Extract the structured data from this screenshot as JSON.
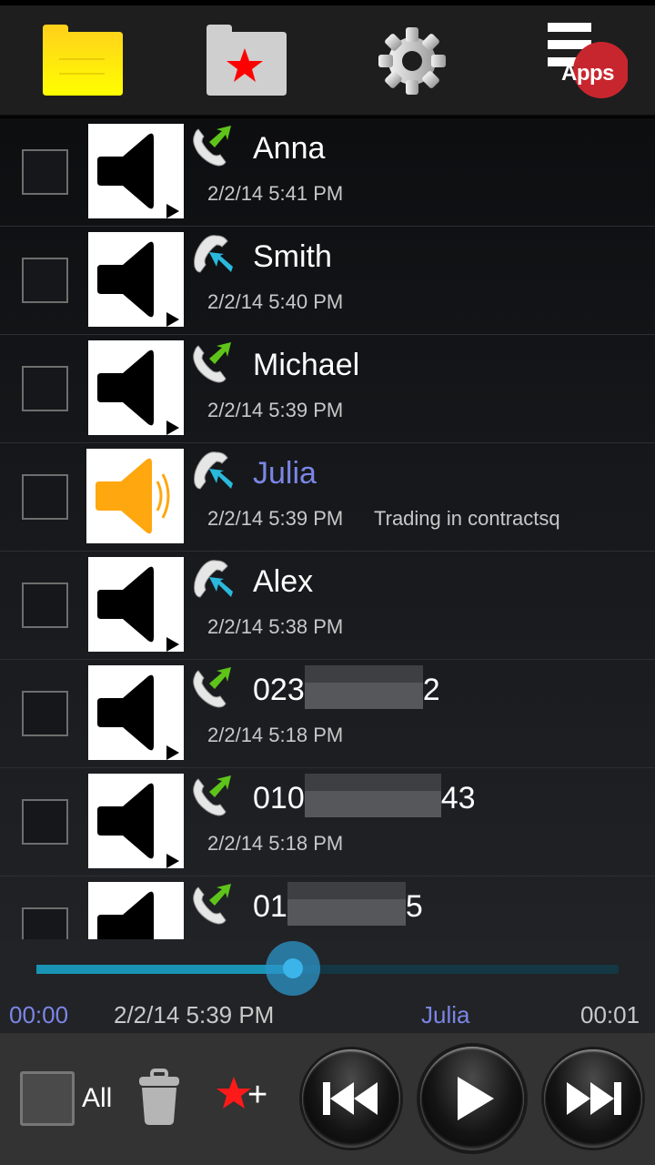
{
  "toolbar": {
    "buttons": [
      {
        "name": "all-recordings-folder",
        "icon": "folder-icon",
        "color": "#ffd81a"
      },
      {
        "name": "favorites-folder",
        "icon": "star-folder-icon",
        "color": "#cfcfcf"
      },
      {
        "name": "settings",
        "icon": "gear-icon",
        "color": "#d0d0d0"
      },
      {
        "name": "apps-menu",
        "icon": "apps-menu-icon",
        "badge": "Apps",
        "badge_color": "#c8262e"
      }
    ]
  },
  "recordings": [
    {
      "name": "Anna",
      "date": "2/2/14 5:41 PM",
      "direction": "outgoing",
      "note": "",
      "active": false,
      "checked": false
    },
    {
      "name": "Smith",
      "date": "2/2/14 5:40 PM",
      "direction": "incoming",
      "note": "",
      "active": false,
      "checked": false
    },
    {
      "name": "Michael",
      "date": "2/2/14 5:39 PM",
      "direction": "outgoing",
      "note": "",
      "active": false,
      "checked": false
    },
    {
      "name": "Julia",
      "date": "2/2/14 5:39 PM",
      "direction": "incoming",
      "note": "Trading in contractsq",
      "active": true,
      "checked": false
    },
    {
      "name": "Alex",
      "date": "2/2/14 5:38 PM",
      "direction": "incoming",
      "note": "",
      "active": false,
      "checked": false
    },
    {
      "name_prefix": "023",
      "name_suffix": "2",
      "redacted": true,
      "date": "2/2/14 5:18 PM",
      "direction": "outgoing",
      "note": "",
      "active": false,
      "checked": false
    },
    {
      "name_prefix": "010",
      "name_suffix": "43",
      "redacted": true,
      "date": "2/2/14 5:18 PM",
      "direction": "outgoing",
      "note": "",
      "active": false,
      "checked": false
    },
    {
      "name_prefix": "01",
      "name_suffix": "5",
      "redacted": true,
      "date": "",
      "direction": "outgoing",
      "note": "",
      "active": false,
      "checked": false
    }
  ],
  "player": {
    "elapsed": "00:00",
    "date": "2/2/14 5:39 PM",
    "contact": "Julia",
    "duration": "00:01",
    "progress": 0.44,
    "accent_color": "#7b86e6",
    "track_color": "#1a94b4"
  },
  "bottom": {
    "select_all_label": "All",
    "delete_icon": "trash-icon",
    "favorite_label": "+",
    "favorite_icon": "star-plus-icon",
    "prev_icon": "skip-previous-icon",
    "play_icon": "play-icon",
    "next_icon": "skip-next-icon"
  }
}
